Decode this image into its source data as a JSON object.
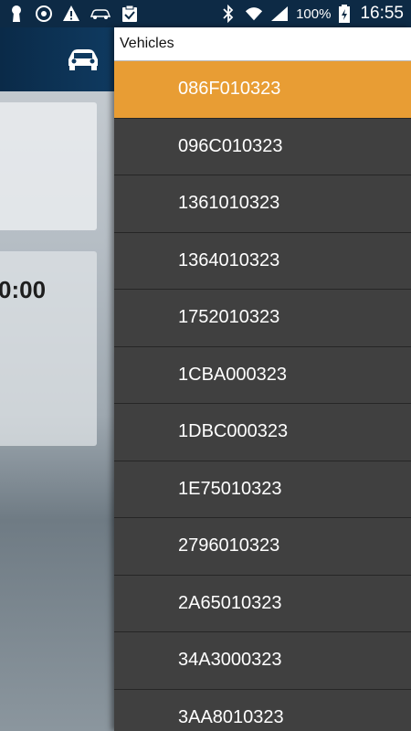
{
  "status_bar": {
    "battery": "100%",
    "time": "16:55",
    "colors": {
      "background": "#0d2a45"
    }
  },
  "background_app": {
    "time_display": "0:00",
    "header_icon": "car-icon"
  },
  "drawer": {
    "title": "Vehicles",
    "selected_index": 0,
    "colors": {
      "selected": "#e89d34",
      "item_bg": "#404040"
    },
    "items": [
      "086F010323",
      "096C010323",
      "1361010323",
      "1364010323",
      "1752010323",
      "1CBA000323",
      "1DBC000323",
      "1E75010323",
      "2796010323",
      "2A65010323",
      "34A3000323",
      "3AA8010323"
    ]
  }
}
